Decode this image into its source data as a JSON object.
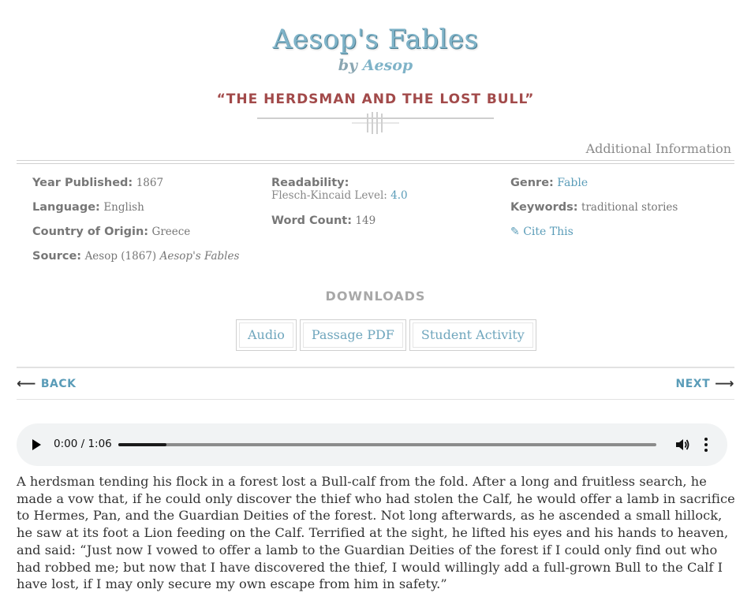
{
  "header": {
    "book_title": "Aesop's Fables",
    "by": "by",
    "author": "Aesop",
    "story_title": "“THE HERDSMAN AND THE LOST BULL”"
  },
  "info": {
    "additional_information": "Additional Information",
    "year_label": "Year Published:",
    "year_value": "1867",
    "language_label": "Language:",
    "language_value": "English",
    "country_label": "Country of Origin:",
    "country_value": "Greece",
    "source_label": "Source:",
    "source_value": "Aesop (1867)",
    "source_title": "Aesop's Fables",
    "readability_label": "Readability:",
    "fk_label": "Flesch-Kincaid Level:",
    "fk_value": "4.0",
    "word_count_label": "Word Count:",
    "word_count_value": "149",
    "genre_label": "Genre:",
    "genre_value": "Fable",
    "keywords_label": "Keywords:",
    "keywords_value": "traditional stories",
    "cite_icon": "✎",
    "cite_label": "Cite This"
  },
  "downloads": {
    "heading": "DOWNLOADS",
    "buttons": [
      "Audio",
      "Passage PDF",
      "Student Activity"
    ]
  },
  "nav": {
    "back": "BACK",
    "next": "NEXT",
    "back_icon": "arrow-left-icon",
    "next_icon": "arrow-right-icon"
  },
  "player": {
    "time": "0:00 / 1:06",
    "progress": 0.09
  },
  "story": {
    "text": "A herdsman tending his flock in a forest lost a Bull-calf from the fold. After a long and fruitless search, he made a vow that, if he could only discover the thief who had stolen the Calf, he would offer a lamb in sacrifice to Hermes, Pan, and the Guardian Deities of the forest. Not long afterwards, as he ascended a small hillock, he saw at its foot a Lion feeding on the Calf. Terrified at the sight, he lifted his eyes and his hands to heaven, and said: “Just now I vowed to offer a lamb to the Guardian Deities of the forest if I could only find out who had robbed me; but now that I have discovered the thief, I would willingly add a full-grown Bull to the Calf I have lost, if I may only secure my own escape from him in safety.”"
  },
  "colors": {
    "accent": "#5a9cb8",
    "title": "#7fb3c8",
    "story_title": "#a24a4a"
  }
}
